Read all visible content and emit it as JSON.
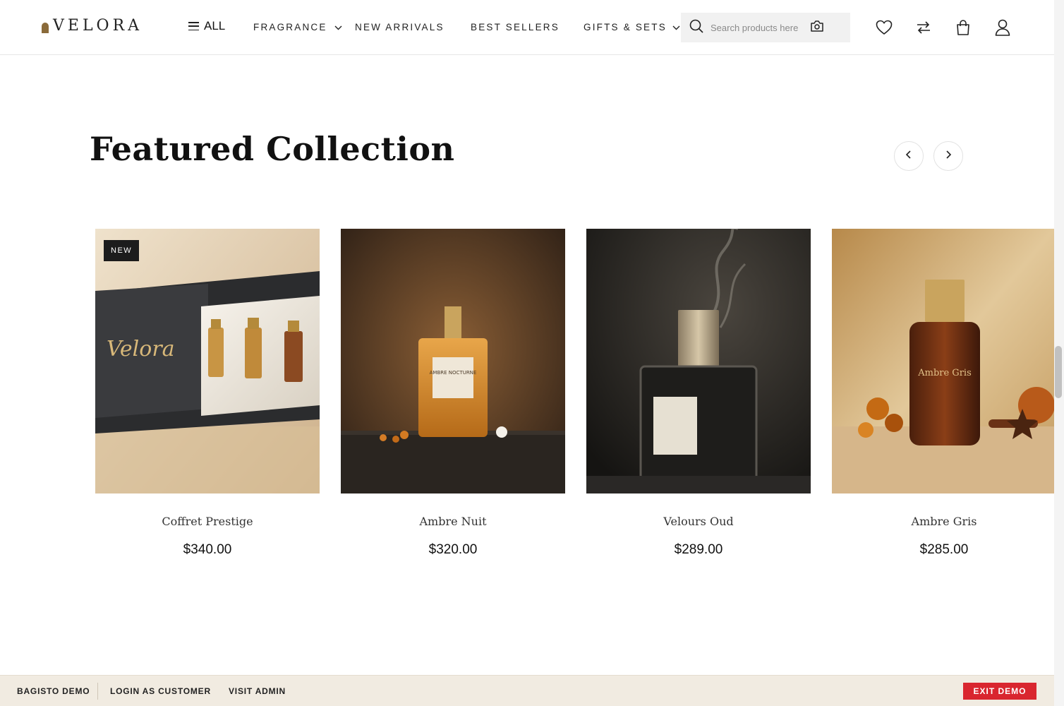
{
  "header": {
    "logo_text": "VELORA",
    "all_label": "ALL",
    "nav": [
      "FRAGRANCE",
      "NEW ARRIVALS",
      "BEST SELLERS",
      "GIFTS & SETS"
    ],
    "search_placeholder": "Search products here",
    "icons": [
      "search-icon",
      "camera-icon",
      "heart-icon",
      "compare-icon",
      "bag-icon",
      "user-icon"
    ]
  },
  "section": {
    "title": "Featured Collection",
    "prev_icon": "chevron-left-icon",
    "next_icon": "chevron-right-icon"
  },
  "products": [
    {
      "name": "Coffret Prestige",
      "price": "$340.00",
      "badge": "NEW",
      "box_text": "Velora"
    },
    {
      "name": "Ambre Nuit",
      "price": "$320.00",
      "label_text": "AMBRE NOCTURNE"
    },
    {
      "name": "Velours Oud",
      "price": "$289.00"
    },
    {
      "name": "Ambre Gris",
      "price": "$285.00",
      "bottle_text": "Ambre Gris"
    }
  ],
  "demo_bar": {
    "brand": "BAGISTO DEMO",
    "login": "LOGIN AS CUSTOMER",
    "admin": "VISIT ADMIN",
    "exit": "EXIT DEMO",
    "exit_color": "#d9262f"
  }
}
